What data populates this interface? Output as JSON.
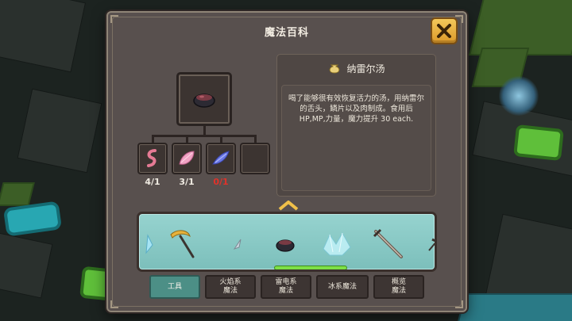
{
  "panel": {
    "title": "魔法百科",
    "close_icon": "close-icon"
  },
  "recipe": {
    "result_icon": "meat-stew-pot-icon",
    "ingredients": [
      {
        "icon": "tongue-icon",
        "count": "4/1"
      },
      {
        "icon": "pink-feather-scale-icon",
        "count": "3/1"
      },
      {
        "icon": "blue-crystal-shard-icon",
        "count": "0/1"
      },
      {
        "icon": "",
        "count": ""
      }
    ]
  },
  "description": {
    "item_icon": "pouch-icon",
    "item_name": "纳雷尔汤",
    "text": "喝了能够很有效恢复活力的汤，用纳雷尔的舌头，鳞片以及肉制成。食用后 HP,MP,力量，魔力提升 30 each."
  },
  "strip_items": [
    "ice-shard-icon",
    "golden-crescent-staff-icon",
    "small-blade-icon",
    "meat-stew-pot-icon",
    "ice-crystal-cluster-icon",
    "long-sword-icon",
    "pickaxe-icon"
  ],
  "tabs": [
    {
      "label": "工具",
      "active": true
    },
    {
      "label": "火焰系\n魔法",
      "active": false
    },
    {
      "label": "雷电系\n魔法",
      "active": false
    },
    {
      "label": "冰系魔法",
      "active": false
    },
    {
      "label": "概览\n魔法",
      "active": false
    }
  ],
  "colors": {
    "accent_button": "#f0b847",
    "strip_background": "#8fcdc8",
    "active_tab": "#4c8f86",
    "missing_count": "#e0322a",
    "scrollbar": "#7de046"
  }
}
